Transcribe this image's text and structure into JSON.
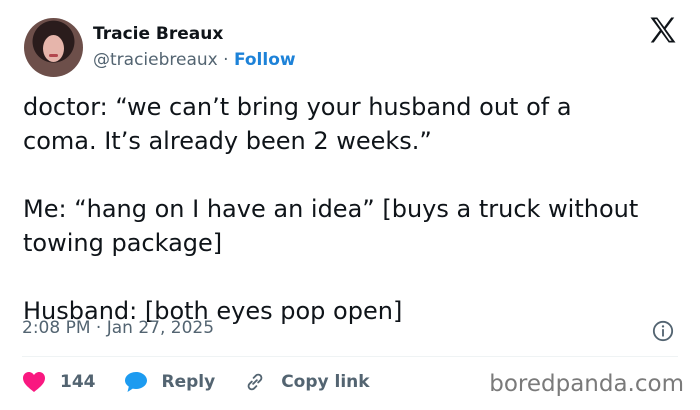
{
  "author": {
    "name": "Tracie Breaux",
    "handle": "@traciebreaux",
    "separator": " · ",
    "follow_label": "Follow"
  },
  "tweet": {
    "text": "doctor: “we can’t bring your husband out of a\ncoma. It’s already been 2 weeks.”\n\nMe: “hang on I have an idea” [buys a truck without\ntowing package]\n\nHusband: [both eyes pop open]",
    "timestamp": "2:08 PM · Jan 27, 2025"
  },
  "actions": {
    "likes": "144",
    "reply_label": "Reply",
    "copy_link_label": "Copy link"
  },
  "watermark": "boredpanda.com",
  "icons": [
    "x-logo-icon",
    "info-icon",
    "heart-icon",
    "reply-bubble-icon",
    "link-icon"
  ],
  "colors": {
    "accent": "#1d82d8",
    "like": "#f91880",
    "muted": "#536471"
  }
}
